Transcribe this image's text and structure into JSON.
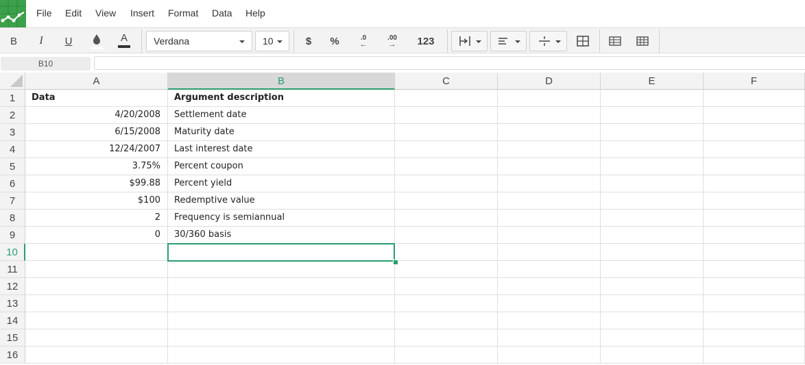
{
  "menu": [
    "File",
    "Edit",
    "View",
    "Insert",
    "Format",
    "Data",
    "Help"
  ],
  "toolbar": {
    "bold": "B",
    "italic": "I",
    "underline": "U",
    "font_color_glyph": "A",
    "font_name": "Verdana",
    "font_size": "10",
    "currency": "$",
    "percent": "%",
    "decimal_decrease": ".0",
    "decimal_increase": ".00",
    "number_format": "123"
  },
  "formula_bar": {
    "cell_ref": "B10",
    "value": ""
  },
  "columns": [
    "A",
    "B",
    "C",
    "D",
    "E",
    "F"
  ],
  "selected_column": "B",
  "selected_row": "10",
  "rows": [
    {
      "n": "1",
      "a": "Data",
      "b": "Argument description"
    },
    {
      "n": "2",
      "a": "4/20/2008",
      "b": "Settlement date"
    },
    {
      "n": "3",
      "a": "6/15/2008",
      "b": "Maturity date"
    },
    {
      "n": "4",
      "a": "12/24/2007",
      "b": "Last interest date"
    },
    {
      "n": "5",
      "a": "3.75%",
      "b": "Percent coupon"
    },
    {
      "n": "6",
      "a": "$99.88",
      "b": "Percent yield"
    },
    {
      "n": "7",
      "a": "$100",
      "b": "Redemptive value"
    },
    {
      "n": "8",
      "a": "2",
      "b": "Frequency is semiannual"
    },
    {
      "n": "9",
      "a": "0",
      "b": "30/360 basis"
    },
    {
      "n": "10",
      "a": "",
      "b": ""
    },
    {
      "n": "11",
      "a": "",
      "b": ""
    },
    {
      "n": "12",
      "a": "",
      "b": ""
    },
    {
      "n": "13",
      "a": "",
      "b": ""
    },
    {
      "n": "14",
      "a": "",
      "b": ""
    },
    {
      "n": "15",
      "a": "",
      "b": ""
    },
    {
      "n": "16",
      "a": "",
      "b": ""
    }
  ],
  "colors": {
    "accent": "#2a9d6e",
    "logo": "#3da14b"
  }
}
